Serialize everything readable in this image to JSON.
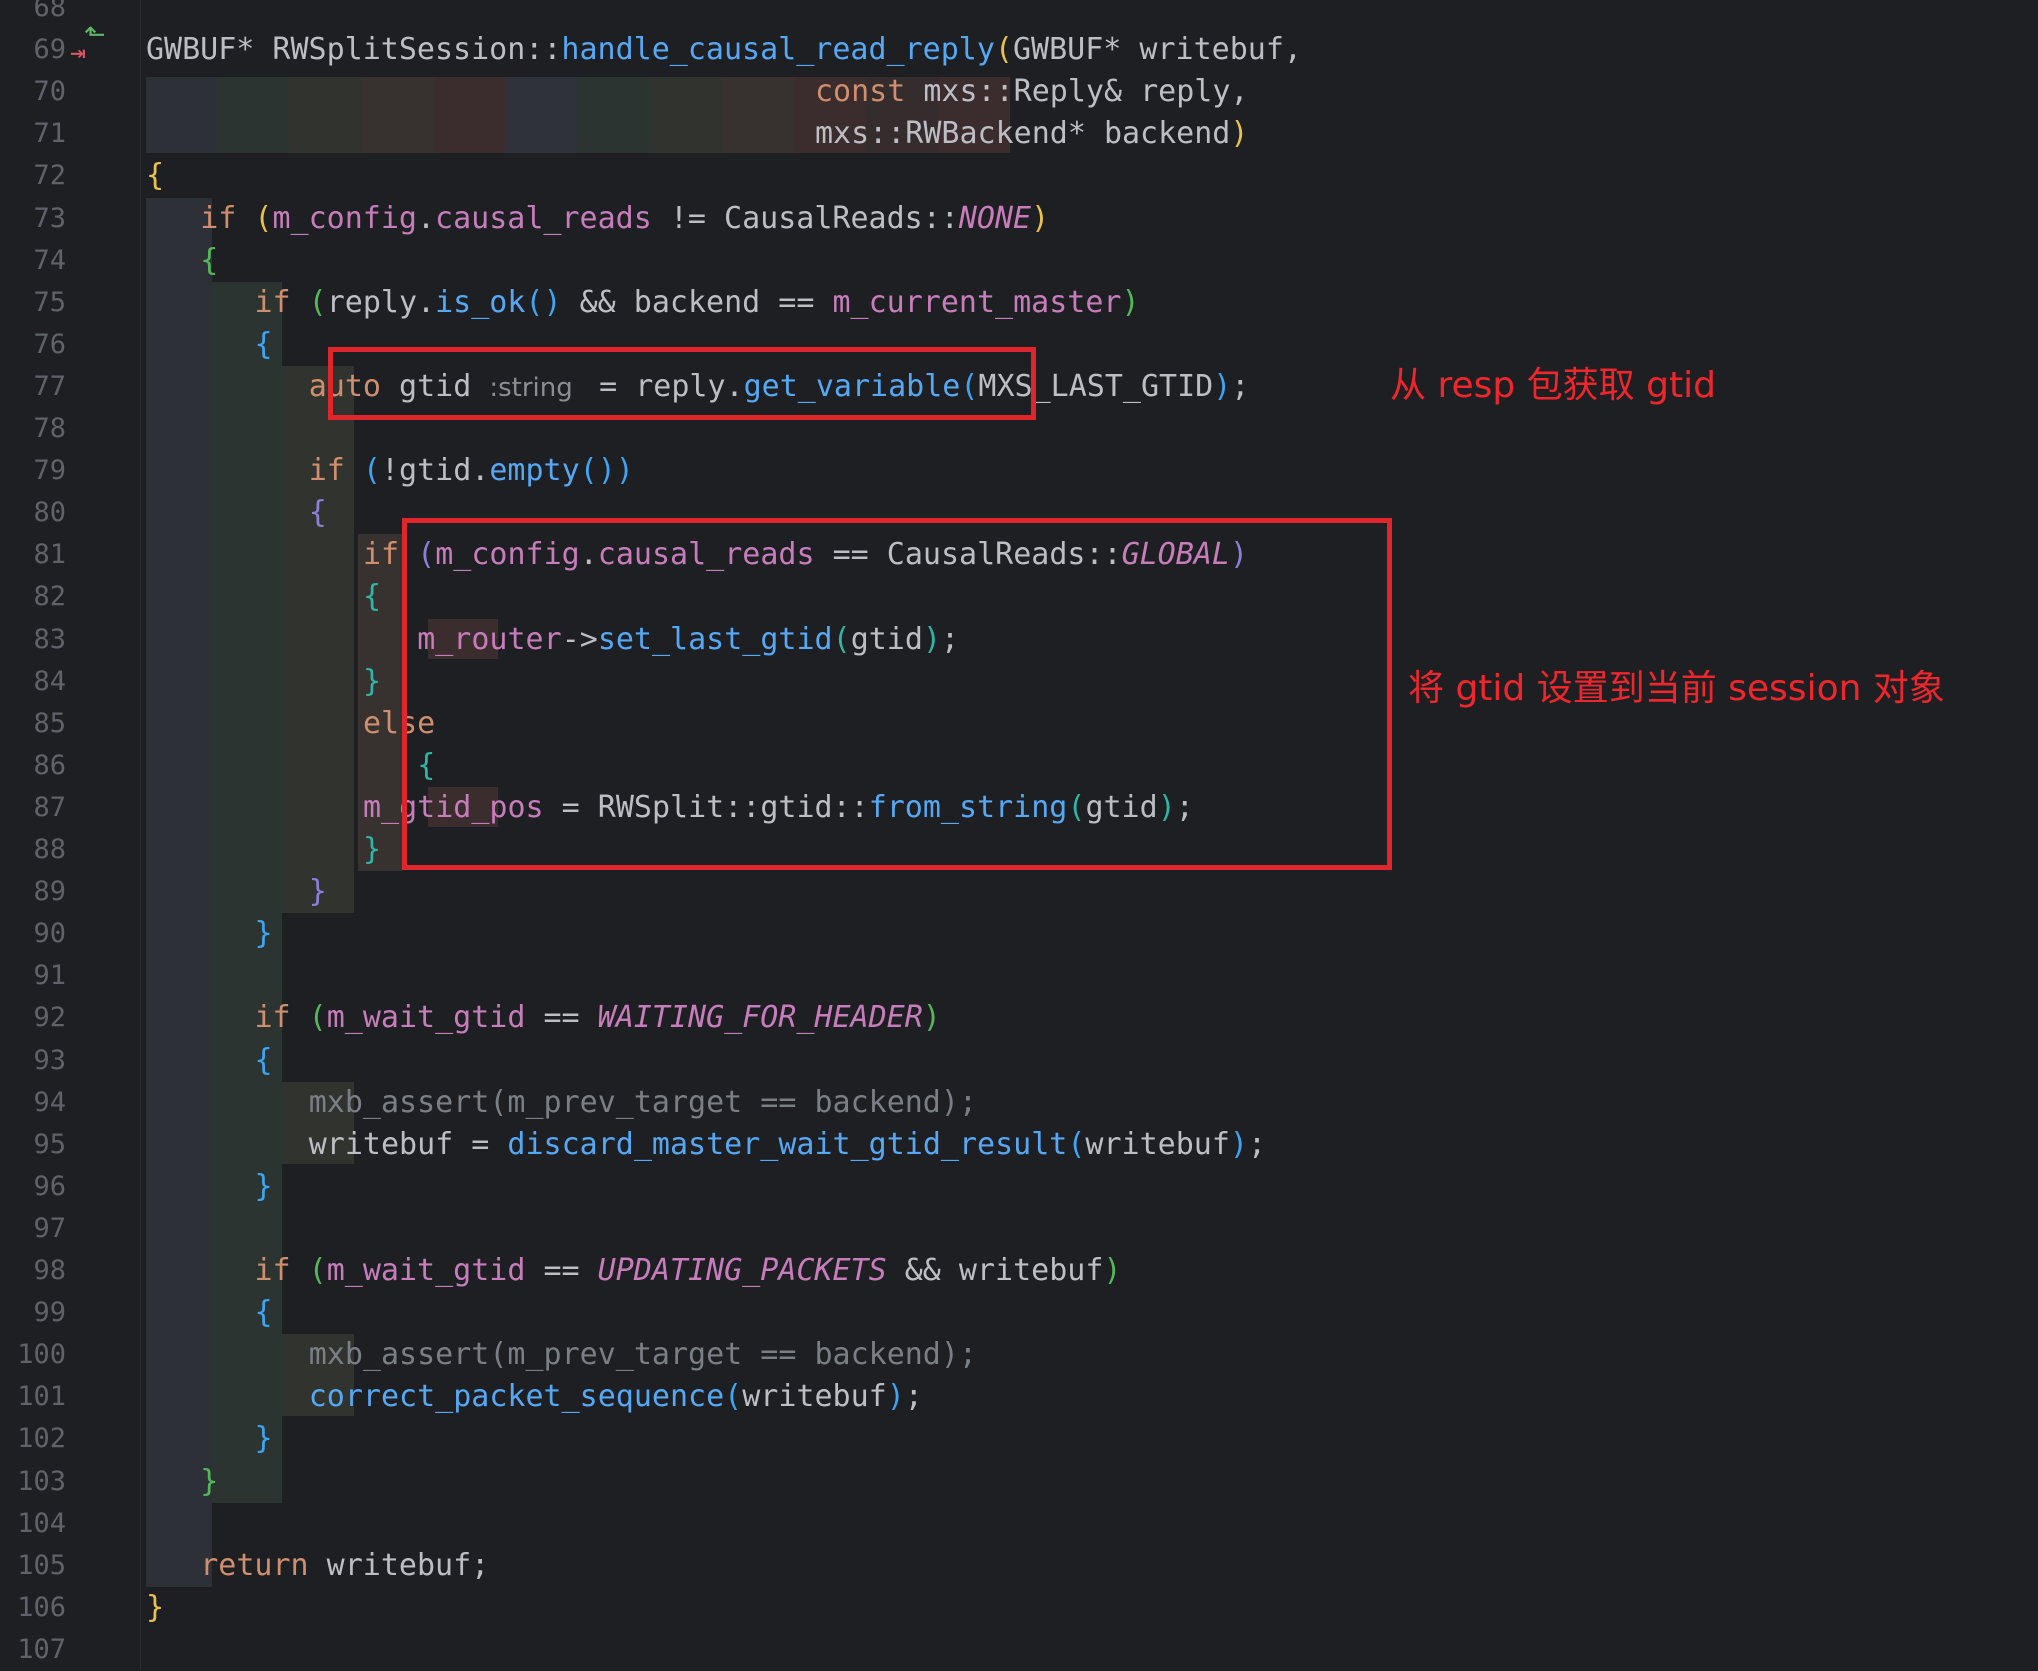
{
  "editor": {
    "gutter_icons": {
      "implements": "arrow-left-up-icon",
      "implemented": "arrow-right-down-icon"
    },
    "colors": {
      "background": "#1e1f22",
      "keyword": "#cf8e6d",
      "function": "#56a8f5",
      "member": "#c77dbb",
      "text": "#bcbec4",
      "comment": "#7a7e85",
      "annotation_red": "#e0262d"
    },
    "lines": [
      {
        "num": "68",
        "tokens": []
      },
      {
        "num": "69",
        "tokens": [
          {
            "t": "GWBUF* RWSplitSession::",
            "c": "txt"
          },
          {
            "t": "handle_causal_read_reply",
            "c": "fn"
          },
          {
            "t": "(",
            "c": "b1"
          },
          {
            "t": "GWBUF* writebuf,",
            "c": "txt"
          }
        ]
      },
      {
        "num": "70",
        "tokens": [
          {
            "t": "const ",
            "c": "kw"
          },
          {
            "t": "mxs::Reply& reply,",
            "c": "txt"
          }
        ]
      },
      {
        "num": "71",
        "tokens": [
          {
            "t": "mxs::RWBackend* backend",
            "c": "txt"
          },
          {
            "t": ")",
            "c": "b1"
          }
        ]
      },
      {
        "num": "72",
        "tokens": [
          {
            "t": "{",
            "c": "b1"
          }
        ]
      },
      {
        "num": "73",
        "tokens": [
          {
            "t": "if ",
            "c": "kw"
          },
          {
            "t": "(",
            "c": "b1"
          },
          {
            "t": "m_config",
            "c": "mem"
          },
          {
            "t": ".",
            "c": "txt"
          },
          {
            "t": "causal_reads",
            "c": "mem"
          },
          {
            "t": " != CausalReads::",
            "c": "txt"
          },
          {
            "t": "NONE",
            "c": "enum"
          },
          {
            "t": ")",
            "c": "b1"
          }
        ]
      },
      {
        "num": "74",
        "tokens": [
          {
            "t": "{",
            "c": "b2"
          }
        ]
      },
      {
        "num": "75",
        "tokens": [
          {
            "t": "if ",
            "c": "kw"
          },
          {
            "t": "(",
            "c": "b2"
          },
          {
            "t": "reply.",
            "c": "txt"
          },
          {
            "t": "is_ok",
            "c": "fn"
          },
          {
            "t": "() ",
            "c": "b3"
          },
          {
            "t": "&& backend == ",
            "c": "txt"
          },
          {
            "t": "m_current_master",
            "c": "mem"
          },
          {
            "t": ")",
            "c": "b2"
          }
        ]
      },
      {
        "num": "76",
        "tokens": [
          {
            "t": "{",
            "c": "b3"
          }
        ]
      },
      {
        "num": "77",
        "tokens": [
          {
            "t": "auto ",
            "c": "kw"
          },
          {
            "t": "gtid ",
            "c": "txt"
          },
          {
            "t": ":string ",
            "c": "hint"
          },
          {
            "t": " = reply.",
            "c": "txt"
          },
          {
            "t": "get_variable",
            "c": "fn"
          },
          {
            "t": "(",
            "c": "b3"
          },
          {
            "t": "MXS_LAST_GTID",
            "c": "txt"
          },
          {
            "t": ")",
            "c": "b3"
          },
          {
            "t": ";",
            "c": "txt"
          }
        ]
      },
      {
        "num": "78",
        "tokens": []
      },
      {
        "num": "79",
        "tokens": [
          {
            "t": "if ",
            "c": "kw"
          },
          {
            "t": "(",
            "c": "b3"
          },
          {
            "t": "!gtid.",
            "c": "txt"
          },
          {
            "t": "empty",
            "c": "fn"
          },
          {
            "t": "()",
            "c": "b3"
          },
          {
            "t": ")",
            "c": "b3"
          }
        ]
      },
      {
        "num": "80",
        "tokens": [
          {
            "t": "{",
            "c": "b4"
          }
        ]
      },
      {
        "num": "81",
        "tokens": [
          {
            "t": "if ",
            "c": "kw"
          },
          {
            "t": "(",
            "c": "b4"
          },
          {
            "t": "m_config",
            "c": "mem"
          },
          {
            "t": ".",
            "c": "txt"
          },
          {
            "t": "causal_reads",
            "c": "mem"
          },
          {
            "t": " == CausalReads::",
            "c": "txt"
          },
          {
            "t": "GLOBAL",
            "c": "enum"
          },
          {
            "t": ")",
            "c": "b4"
          }
        ]
      },
      {
        "num": "82",
        "tokens": [
          {
            "t": "{",
            "c": "b5"
          }
        ]
      },
      {
        "num": "83",
        "tokens": [
          {
            "t": "m_router",
            "c": "mem"
          },
          {
            "t": "->",
            "c": "txt"
          },
          {
            "t": "set_last_gtid",
            "c": "fn"
          },
          {
            "t": "(",
            "c": "b5"
          },
          {
            "t": "gtid",
            "c": "txt"
          },
          {
            "t": ")",
            "c": "b5"
          },
          {
            "t": ";",
            "c": "txt"
          }
        ]
      },
      {
        "num": "84",
        "tokens": [
          {
            "t": "}",
            "c": "b5"
          }
        ]
      },
      {
        "num": "85",
        "tokens": [
          {
            "t": "else",
            "c": "kw"
          }
        ]
      },
      {
        "num": "86",
        "tokens": [
          {
            "t": "{",
            "c": "b5"
          }
        ]
      },
      {
        "num": "87",
        "tokens": [
          {
            "t": "m_gtid_pos",
            "c": "mem"
          },
          {
            "t": " = RWSplit::gtid::",
            "c": "txt"
          },
          {
            "t": "from_string",
            "c": "fn"
          },
          {
            "t": "(",
            "c": "b5"
          },
          {
            "t": "gtid",
            "c": "txt"
          },
          {
            "t": ")",
            "c": "b5"
          },
          {
            "t": ";",
            "c": "txt"
          }
        ]
      },
      {
        "num": "88",
        "tokens": [
          {
            "t": "}",
            "c": "b5"
          }
        ]
      },
      {
        "num": "89",
        "tokens": [
          {
            "t": "}",
            "c": "b4"
          }
        ]
      },
      {
        "num": "90",
        "tokens": [
          {
            "t": "}",
            "c": "b3"
          }
        ]
      },
      {
        "num": "91",
        "tokens": []
      },
      {
        "num": "92",
        "tokens": [
          {
            "t": "if ",
            "c": "kw"
          },
          {
            "t": "(",
            "c": "b2"
          },
          {
            "t": "m_wait_gtid",
            "c": "mem"
          },
          {
            "t": " == ",
            "c": "txt"
          },
          {
            "t": "WAITING_FOR_HEADER",
            "c": "enum"
          },
          {
            "t": ")",
            "c": "b2"
          }
        ]
      },
      {
        "num": "93",
        "tokens": [
          {
            "t": "{",
            "c": "b3"
          }
        ]
      },
      {
        "num": "94",
        "tokens": [
          {
            "t": "mxb_assert(m_prev_target == backend);",
            "c": "cmt"
          }
        ]
      },
      {
        "num": "95",
        "tokens": [
          {
            "t": "writebuf = ",
            "c": "txt"
          },
          {
            "t": "discard_master_wait_gtid_result",
            "c": "fn"
          },
          {
            "t": "(",
            "c": "b3"
          },
          {
            "t": "writebuf",
            "c": "txt"
          },
          {
            "t": ")",
            "c": "b3"
          },
          {
            "t": ";",
            "c": "txt"
          }
        ]
      },
      {
        "num": "96",
        "tokens": [
          {
            "t": "}",
            "c": "b3"
          }
        ]
      },
      {
        "num": "97",
        "tokens": []
      },
      {
        "num": "98",
        "tokens": [
          {
            "t": "if ",
            "c": "kw"
          },
          {
            "t": "(",
            "c": "b2"
          },
          {
            "t": "m_wait_gtid",
            "c": "mem"
          },
          {
            "t": " == ",
            "c": "txt"
          },
          {
            "t": "UPDATING_PACKETS",
            "c": "enum"
          },
          {
            "t": " && writebuf",
            "c": "txt"
          },
          {
            "t": ")",
            "c": "b2"
          }
        ]
      },
      {
        "num": "99",
        "tokens": [
          {
            "t": "{",
            "c": "b3"
          }
        ]
      },
      {
        "num": "100",
        "tokens": [
          {
            "t": "mxb_assert(m_prev_target == backend);",
            "c": "cmt"
          }
        ]
      },
      {
        "num": "101",
        "tokens": [
          {
            "t": "correct_packet_sequence",
            "c": "fn"
          },
          {
            "t": "(",
            "c": "b3"
          },
          {
            "t": "writebuf",
            "c": "txt"
          },
          {
            "t": ")",
            "c": "b3"
          },
          {
            "t": ";",
            "c": "txt"
          }
        ]
      },
      {
        "num": "102",
        "tokens": [
          {
            "t": "}",
            "c": "b3"
          }
        ]
      },
      {
        "num": "103",
        "tokens": [
          {
            "t": "}",
            "c": "b2"
          }
        ]
      },
      {
        "num": "104",
        "tokens": []
      },
      {
        "num": "105",
        "tokens": [
          {
            "t": "return ",
            "c": "kw"
          },
          {
            "t": "writebuf;",
            "c": "txt"
          }
        ]
      },
      {
        "num": "106",
        "tokens": [
          {
            "t": "}",
            "c": "b1"
          }
        ]
      },
      {
        "num": "107",
        "tokens": []
      }
    ]
  },
  "annotations": [
    {
      "text": "从 resp 包获取 gtid"
    },
    {
      "text": "将 gtid 设置到当前 session 对象"
    }
  ]
}
